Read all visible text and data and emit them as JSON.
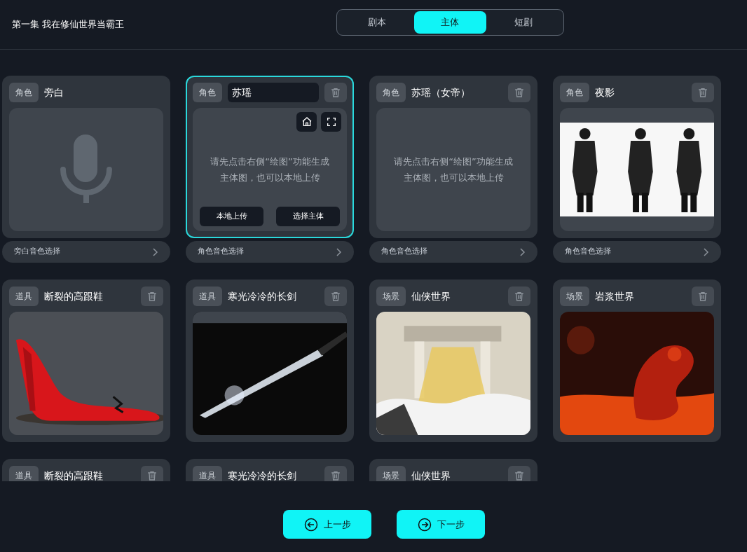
{
  "header": {
    "title": "第一集 我在修仙世界当霸王",
    "tabs": [
      {
        "label": "剧本",
        "selected": false
      },
      {
        "label": "主体",
        "selected": true
      },
      {
        "label": "短剧",
        "selected": false
      }
    ]
  },
  "cards": [
    {
      "tag": "角色",
      "name": "旁白",
      "selected": false,
      "deletable": false,
      "media": {
        "kind": "voice"
      },
      "voice": "旁白音色选择"
    },
    {
      "tag": "角色",
      "name": "苏瑶",
      "selected": true,
      "deletable": true,
      "media": {
        "kind": "prompt",
        "text": "请先点击右侧“绘图”功能生成主体图，也可以本地上传",
        "actions": [
          "本地上传",
          "选择主体"
        ]
      },
      "voice": "角色音色选择"
    },
    {
      "tag": "角色",
      "name": "苏瑶（女帝）",
      "selected": false,
      "deletable": true,
      "media": {
        "kind": "prompt",
        "text": "请先点击右侧“绘图”功能生成主体图，也可以本地上传"
      },
      "voice": "角色音色选择"
    },
    {
      "tag": "角色",
      "name": "夜影",
      "selected": false,
      "deletable": true,
      "voice": "角色音色选择"
    },
    {
      "tag": "道具",
      "name": "断裂的高跟鞋",
      "selected": false,
      "deletable": true
    },
    {
      "tag": "道具",
      "name": "寒光冷冷的长剑",
      "selected": false,
      "deletable": true
    },
    {
      "tag": "场景",
      "name": "仙侠世界",
      "selected": false,
      "deletable": true
    },
    {
      "tag": "场景",
      "name": "岩浆世界",
      "selected": false,
      "deletable": true
    },
    {
      "tag": "道具",
      "name": "断裂的高跟鞋",
      "selected": false,
      "deletable": true
    },
    {
      "tag": "道具",
      "name": "寒光冷冷的长剑",
      "selected": false,
      "deletable": true
    },
    {
      "tag": "场景",
      "name": "仙侠世界",
      "selected": false,
      "deletable": true
    }
  ],
  "footer": {
    "buttons": [
      {
        "label": "上一步",
        "kind": "back"
      },
      {
        "label": "下一步",
        "kind": "next"
      }
    ]
  }
}
